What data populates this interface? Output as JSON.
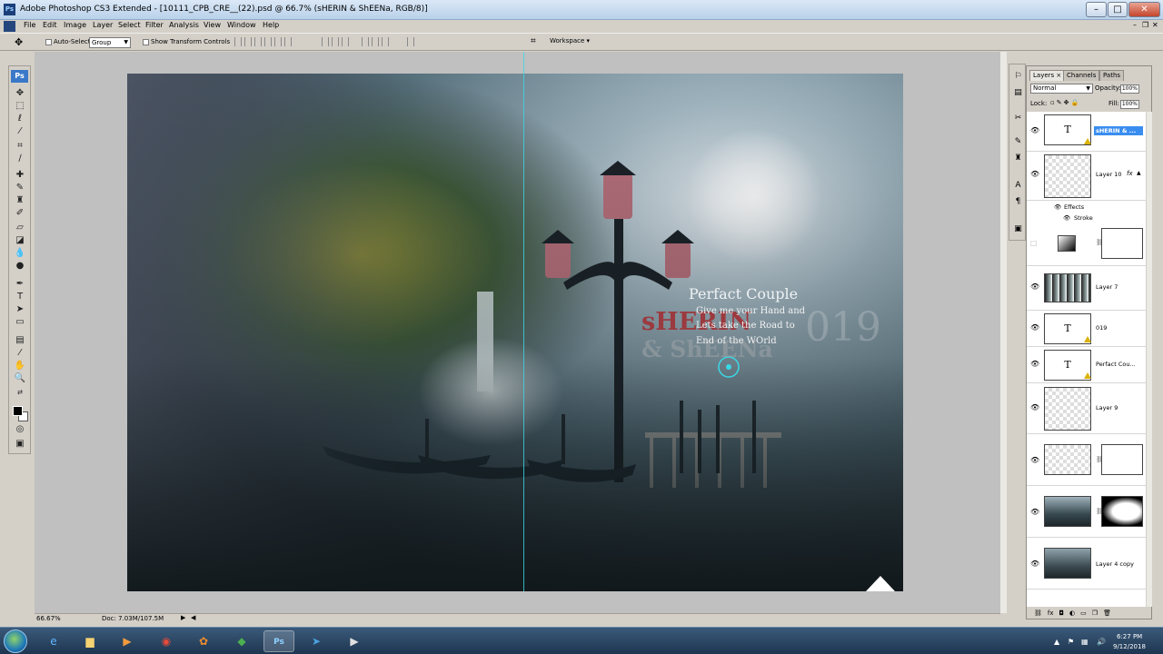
{
  "window": {
    "title": "Adobe Photoshop CS3 Extended - [10111_CPB_CRE__(22).psd @ 66.7% (sHERIN & ShEENa, RGB/8)]",
    "app_badge": "Ps"
  },
  "menu": [
    "File",
    "Edit",
    "Image",
    "Layer",
    "Select",
    "Filter",
    "Analysis",
    "View",
    "Window",
    "Help"
  ],
  "options_bar": {
    "auto_select_label": "Auto-Select:",
    "auto_select_value": "Group",
    "show_transform_label": "Show Transform Controls",
    "workspace_label": "Workspace ▾"
  },
  "toolbox": {
    "logo": "Ps",
    "tools": [
      "move-tool",
      "marquee-tool",
      "lasso-tool",
      "magic-wand-tool",
      "crop-tool",
      "slice-tool",
      "healing-brush-tool",
      "brush-tool",
      "clone-stamp-tool",
      "history-brush-tool",
      "eraser-tool",
      "gradient-tool",
      "blur-tool",
      "dodge-tool",
      "pen-tool",
      "type-tool",
      "path-selection-tool",
      "shape-tool",
      "notes-tool",
      "eyedropper-tool",
      "hand-tool",
      "zoom-tool"
    ],
    "foreground_color": "#000000",
    "background_color": "#ffffff"
  },
  "canvas": {
    "text_perfect_couple": "Perfact  Couple",
    "text_line1": "Give me your  Hand  and",
    "text_line2": "Lets take the Road to",
    "text_line3": "End of the WOrld",
    "text_sherin": "sHERIN",
    "text_sheena": "& ShEENa",
    "text_019": "019"
  },
  "status": {
    "zoom": "66.67%",
    "doc": "Doc: 7.03M/107.5M"
  },
  "layers_panel": {
    "tabs": [
      "Layers ×",
      "Channels",
      "Paths"
    ],
    "blend_mode": "Normal",
    "opacity_label": "Opacity:",
    "opacity_value": "100%",
    "lock_label": "Lock:",
    "fill_label": "Fill:",
    "fill_value": "100%",
    "effects_label": "Effects",
    "stroke_label": "Stroke",
    "layers": [
      {
        "name": "sHERIN & ...",
        "kind": "type",
        "selected": true
      },
      {
        "name": "Layer 10",
        "kind": "checker",
        "fx": "fx"
      },
      {
        "name": "",
        "kind": "adjust"
      },
      {
        "name": "Layer 7",
        "kind": "checker"
      },
      {
        "name": "019",
        "kind": "type"
      },
      {
        "name": "Perfact Cou...",
        "kind": "type"
      },
      {
        "name": "Layer 9",
        "kind": "checker"
      },
      {
        "name": "",
        "kind": "masked"
      },
      {
        "name": "",
        "kind": "photo-mask"
      },
      {
        "name": "Layer 4 copy",
        "kind": "photo"
      }
    ]
  },
  "taskbar": {
    "time": "6:27 PM",
    "date": "9/12/2018",
    "apps": [
      "internet-explorer-icon",
      "file-explorer-icon",
      "media-player-icon",
      "chrome-icon",
      "paint-icon",
      "camtasia-icon",
      "photoshop-icon",
      "telegram-icon",
      "movie-maker-icon"
    ]
  },
  "colors": {
    "selection_blue": "#3a8df0",
    "guide_cyan": "#3ad8e6",
    "sherin_red": "#9b3a3f"
  }
}
